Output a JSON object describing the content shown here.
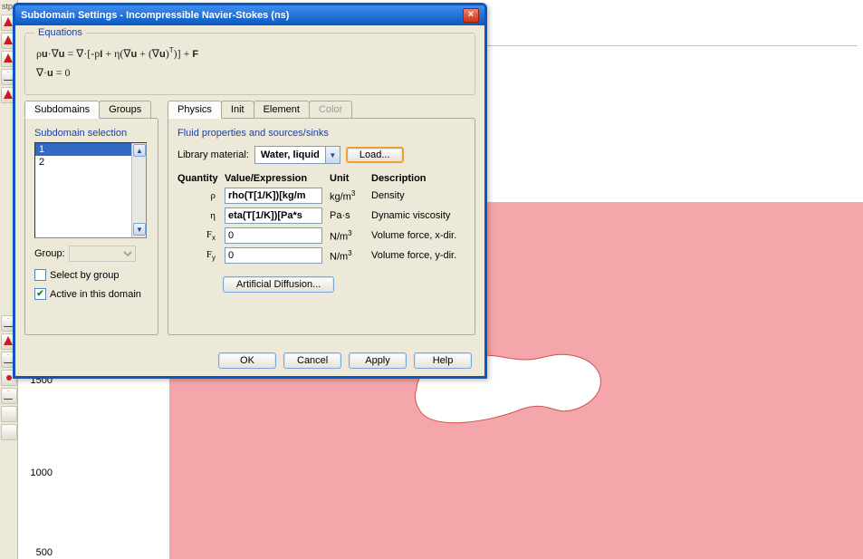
{
  "dialog": {
    "title": "Subdomain Settings - Incompressible Navier-Stokes (ns)",
    "equations_legend": "Equations",
    "eq1_html": "ρ<b>u</b>·∇<b>u</b> = ∇·[-p<b>I</b> + η(∇<b>u</b> + (∇<b>u</b>)<sup>T</sup>)] + <b>F</b>",
    "eq2_html": "∇·<b>u</b> = 0",
    "left_tabs": {
      "tab0": "Subdomains",
      "tab1": "Groups"
    },
    "selection_label": "Subdomain selection",
    "items": {
      "0": "1",
      "1": "2"
    },
    "group_label": "Group:",
    "select_by_group": "Select by group",
    "active_in_domain": "Active in this domain",
    "right_tabs": {
      "tab0": "Physics",
      "tab1": "Init",
      "tab2": "Element",
      "tab3": "Color"
    },
    "props_title": "Fluid properties and sources/sinks",
    "library_label": "Library material:",
    "library_value": "Water, liquid",
    "load_btn": "Load...",
    "headers": {
      "qty": "Quantity",
      "val": "Value/Expression",
      "unit": "Unit",
      "desc": "Description"
    },
    "rows": {
      "rho": {
        "sym": "ρ",
        "val": "rho(T[1/K])[kg/m",
        "unit_html": "kg/m<sup>3</sup>",
        "desc": "Density"
      },
      "eta": {
        "sym": "η",
        "val": "eta(T[1/K])[Pa*s",
        "unit_html": "Pa·s",
        "desc": "Dynamic viscosity"
      },
      "fx": {
        "sym_html": "F<sub>x</sub>",
        "val": "0",
        "unit_html": "N/m<sup>3</sup>",
        "desc": "Volume force, x-dir."
      },
      "fy": {
        "sym_html": "F<sub>y</sub>",
        "val": "0",
        "unit_html": "N/m<sup>3</sup>",
        "desc": "Volume force, y-dir."
      }
    },
    "artificial_btn": "Artificial Diffusion...",
    "buttons": {
      "ok": "OK",
      "cancel": "Cancel",
      "apply": "Apply",
      "help": "Help"
    }
  },
  "axis": {
    "y1500": "1500",
    "y1000": "1000",
    "y500": "500"
  },
  "misc": {
    "stp": "stp"
  }
}
